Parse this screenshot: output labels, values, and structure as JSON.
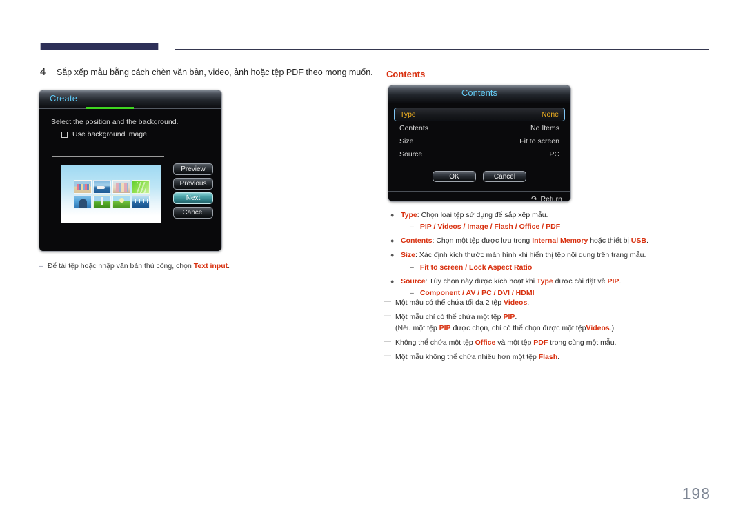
{
  "header": {
    "accent_color": "#2e3058",
    "rule_color": "#35374f"
  },
  "step": {
    "number": "4",
    "text": "Sắp xếp mẫu bằng cách chèn văn bản, video, ảnh hoặc tệp PDF theo mong muốn."
  },
  "create_dialog": {
    "title": "Create",
    "accent_underline_color": "#3fd520",
    "instruction": "Select the position and the background.",
    "checkbox_label": "Use background image",
    "checkbox_checked": false,
    "buttons": [
      {
        "label": "Preview",
        "focused": false
      },
      {
        "label": "Previous",
        "focused": false
      },
      {
        "label": "Next",
        "focused": true
      },
      {
        "label": "Cancel",
        "focused": false
      }
    ]
  },
  "left_note": {
    "dash": "–",
    "prefix": "Để tải tệp hoặc nhập văn bản thủ công, chọn ",
    "emphasis": "Text input",
    "suffix": "."
  },
  "contents_heading": {
    "text": "Contents",
    "color": "#d8300f"
  },
  "contents_dialog": {
    "title": "Contents",
    "rows": [
      {
        "label": "Type",
        "value": "None",
        "highlighted": true
      },
      {
        "label": "Contents",
        "value": "No Items",
        "highlighted": false
      },
      {
        "label": "Size",
        "value": "Fit to screen",
        "highlighted": false
      },
      {
        "label": "Source",
        "value": "PC",
        "highlighted": false
      }
    ],
    "buttons": [
      {
        "label": "OK"
      },
      {
        "label": "Cancel"
      }
    ],
    "footer": {
      "icon": "return-arrow-icon",
      "label": "Return"
    }
  },
  "bullets": [
    {
      "term": "Type",
      "body": ": Chọn loại tệp sử dụng để sắp xếp mẫu.",
      "sub_dash": "–",
      "sub_options": "PIP / Videos / Image / Flash / Office / PDF"
    },
    {
      "term": "Contents",
      "body_pre": ": Chọn một tệp được lưu trong ",
      "body_em1": "Internal Memory",
      "body_mid": " hoặc thiết bị ",
      "body_em2": "USB",
      "body_post": "."
    },
    {
      "term": "Size",
      "body": ": Xác định kích thước màn hình khi hiển thị tệp nội dung trên trang mẫu.",
      "sub_dash": "–",
      "sub_options": "Fit to screen / Lock Aspect Ratio"
    },
    {
      "term": "Source",
      "body_pre": ": Tùy chọn này được kích hoạt khi ",
      "body_em1": "Type",
      "body_mid": " được cài đặt về ",
      "body_em2": "PIP",
      "body_post": ".",
      "sub_dash": "–",
      "sub_options": "Component / AV / PC / DVI / HDMI"
    }
  ],
  "notes": [
    {
      "dash": "—",
      "pre": "Một mẫu có thể chứa tối đa 2 tệp ",
      "em": "Videos",
      "post": "."
    },
    {
      "dash": "—",
      "pre": "Một mẫu chỉ có thể chứa một tệp ",
      "em": "PIP",
      "post": ".",
      "sub_pre": "(Nếu một tệp ",
      "sub_em1": "PIP",
      "sub_mid": " được chọn, chỉ có thể chọn được một tệp",
      "sub_em2": "Videos",
      "sub_post": ".)"
    },
    {
      "dash": "—",
      "pre": "Không thể chứa một tệp ",
      "em": "Office",
      "mid": " và một tệp ",
      "em2": "PDF",
      "post": " trong cùng một mẫu."
    },
    {
      "dash": "—",
      "pre": "Một mẫu không thể chứa nhiều hơn một tệp ",
      "em": "Flash",
      "post": "."
    }
  ],
  "page_number": "198"
}
